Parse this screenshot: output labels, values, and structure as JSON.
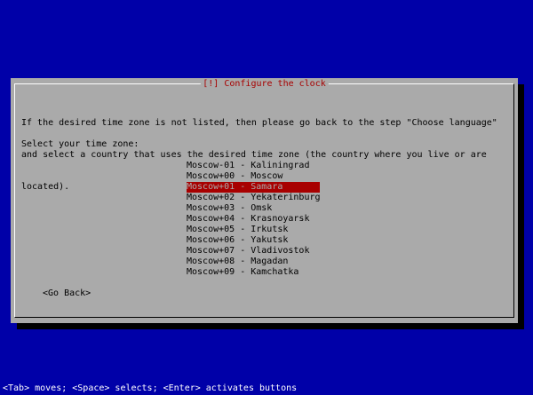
{
  "dialog": {
    "title": "[!] Configure the clock",
    "description_lines": [
      "If the desired time zone is not listed, then please go back to the step \"Choose language\"",
      "and select a country that uses the desired time zone (the country where you live or are",
      "located)."
    ],
    "prompt": "Select your time zone:",
    "timezones": [
      "Moscow-01 - Kaliningrad",
      "Moscow+00 - Moscow",
      "Moscow+01 - Samara",
      "Moscow+02 - Yekaterinburg",
      "Moscow+03 - Omsk",
      "Moscow+04 - Krasnoyarsk",
      "Moscow+05 - Irkutsk",
      "Moscow+06 - Yakutsk",
      "Moscow+07 - Vladivostok",
      "Moscow+08 - Magadan",
      "Moscow+09 - Kamchatka"
    ],
    "selected": "Moscow+01 - Samara",
    "go_back_label": "<Go Back>"
  },
  "status_bar": {
    "text": "<Tab> moves; <Space> selects; <Enter> activates buttons"
  },
  "colors": {
    "background": "#0000a8",
    "dialog": "#aaaaaa",
    "title": "#a80000",
    "selection": "#a80000",
    "status_text": "#ffffff"
  }
}
